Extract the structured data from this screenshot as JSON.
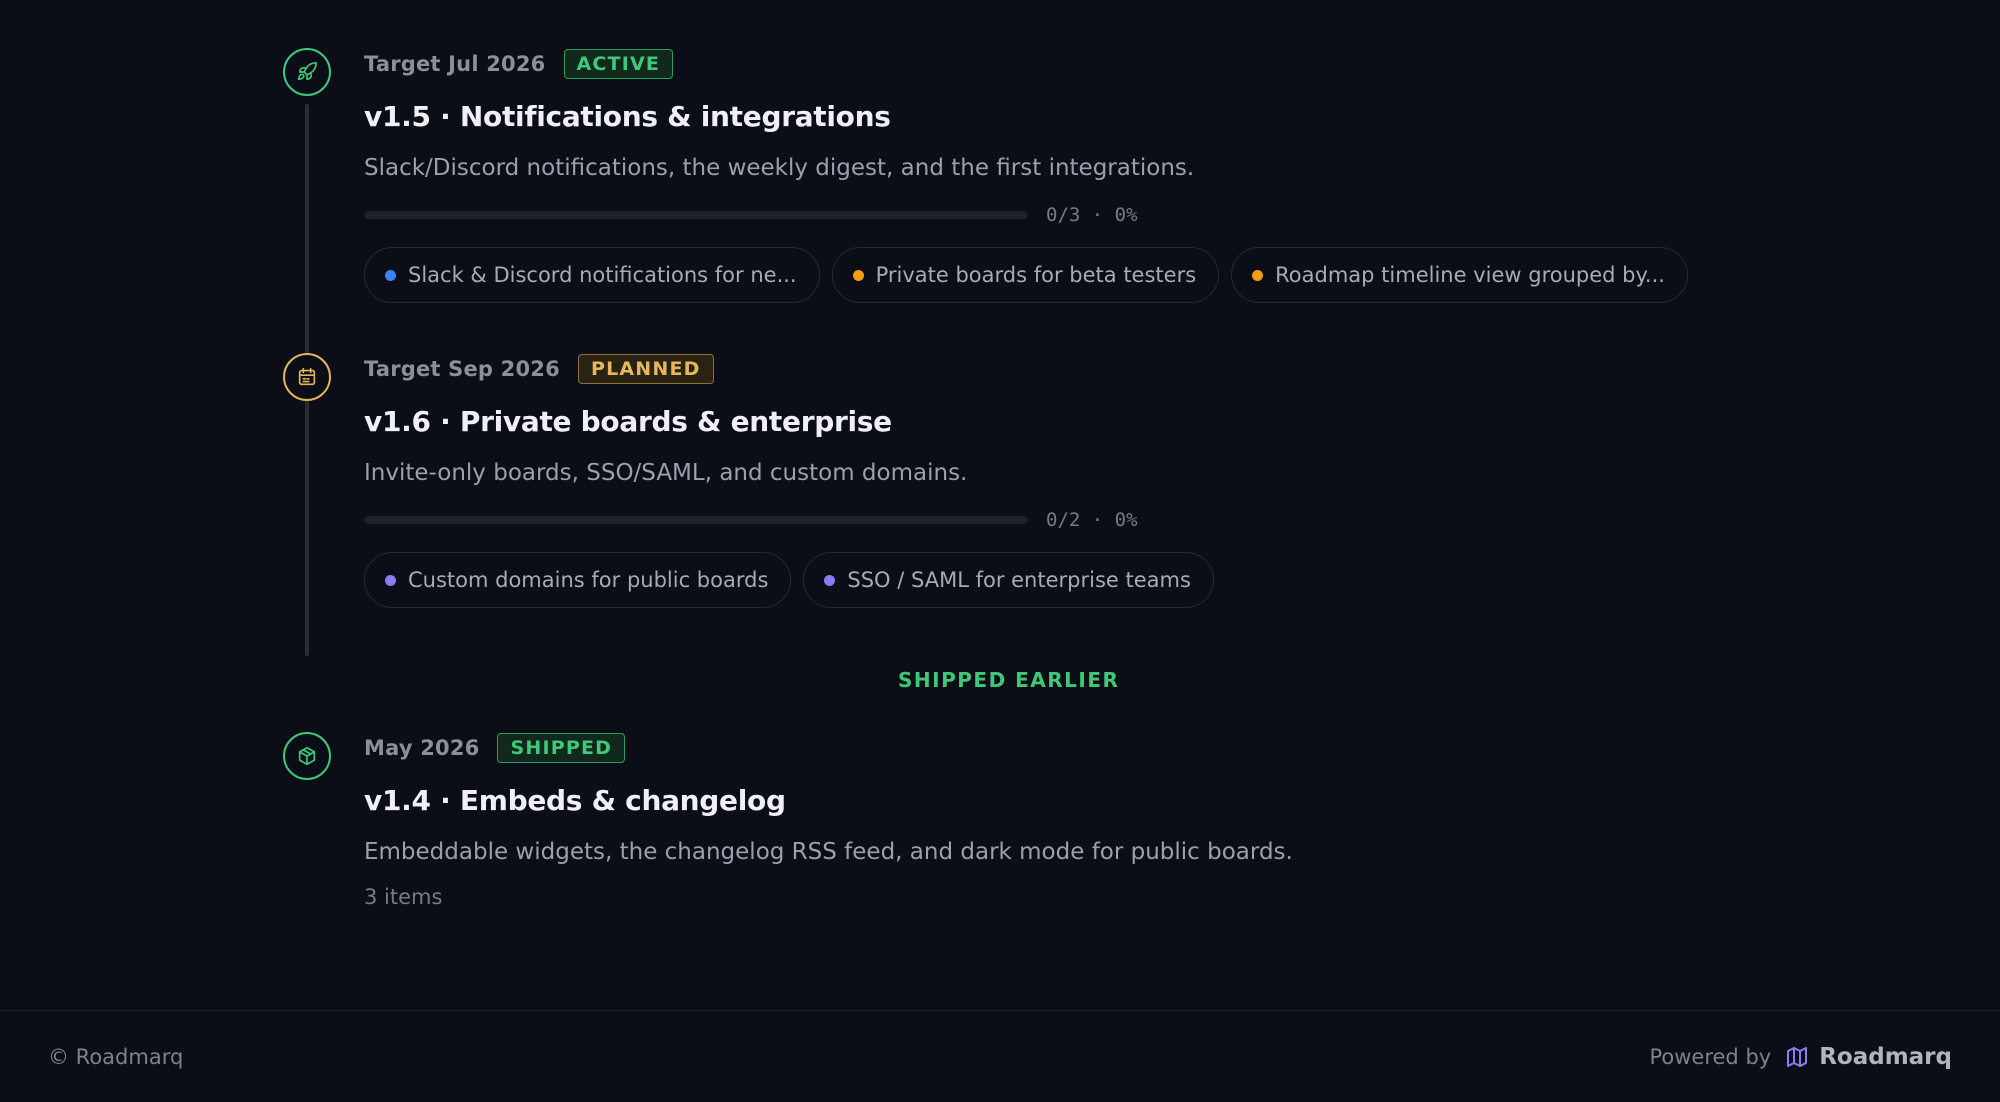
{
  "milestones": [
    {
      "target": "Target Jul 2026",
      "status": "ACTIVE",
      "icon": "rocket-icon",
      "title": "v1.5 · Notifications & integrations",
      "description": "Slack/Discord notifications, the weekly digest, and the first integrations.",
      "progress_text": "0/3 · 0%",
      "progress_fraction": 0,
      "items": [
        {
          "label": "Slack & Discord notifications for ne...",
          "dot_color": "#3b82f6"
        },
        {
          "label": "Private boards for beta testers",
          "dot_color": "#f59e0b"
        },
        {
          "label": "Roadmap timeline view grouped by...",
          "dot_color": "#f59e0b"
        }
      ]
    },
    {
      "target": "Target Sep 2026",
      "status": "PLANNED",
      "icon": "calendar-icon",
      "title": "v1.6 · Private boards & enterprise",
      "description": "Invite-only boards, SSO/SAML, and custom domains.",
      "progress_text": "0/2 · 0%",
      "progress_fraction": 0,
      "items": [
        {
          "label": "Custom domains for public boards",
          "dot_color": "#8b7cf6"
        },
        {
          "label": "SSO / SAML for enterprise teams",
          "dot_color": "#8b7cf6"
        }
      ]
    }
  ],
  "shipped_section_label": "SHIPPED EARLIER",
  "shipped": [
    {
      "target": "May 2026",
      "status": "SHIPPED",
      "icon": "package-icon",
      "title": "v1.4 · Embeds & changelog",
      "description": "Embeddable widgets, the changelog RSS feed, and dark mode for public boards.",
      "items_count": "3 items"
    }
  ],
  "footer": {
    "copyright": "© Roadmarq",
    "powered_by": "Powered by",
    "brand": "Roadmarq",
    "brand_icon": "map-icon"
  },
  "colors": {
    "background": "#0b0e16",
    "active": "#3ec97a",
    "planned": "#e4b95b",
    "accent_purple": "#8b7cf6"
  }
}
